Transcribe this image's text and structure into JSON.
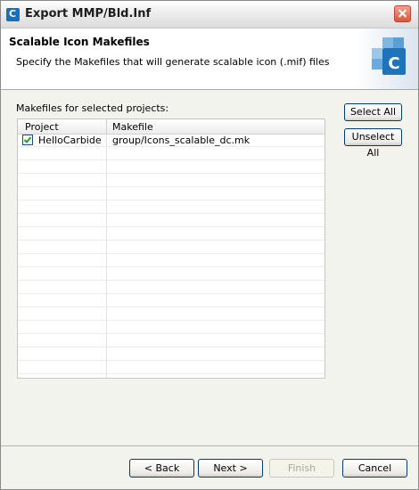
{
  "window": {
    "title": "Export MMP/Bld.Inf"
  },
  "header": {
    "title": "Scalable Icon Makefiles",
    "description": "Specify the Makefiles that will generate scalable icon (.mif) files"
  },
  "section": {
    "label": "Makefiles for selected projects:"
  },
  "table": {
    "columns": [
      "Project",
      "Makefile"
    ],
    "rows": [
      {
        "checked": true,
        "project": "HelloCarbide",
        "makefile": "group/Icons_scalable_dc.mk"
      }
    ]
  },
  "side_buttons": {
    "select_all": "Select All",
    "unselect_all": "Unselect All"
  },
  "footer": {
    "back": "< Back",
    "next": "Next >",
    "finish": "Finish",
    "cancel": "Cancel"
  },
  "colors": {
    "accent": "#1b6fb6",
    "disabled_text": "#a7a6a0"
  }
}
